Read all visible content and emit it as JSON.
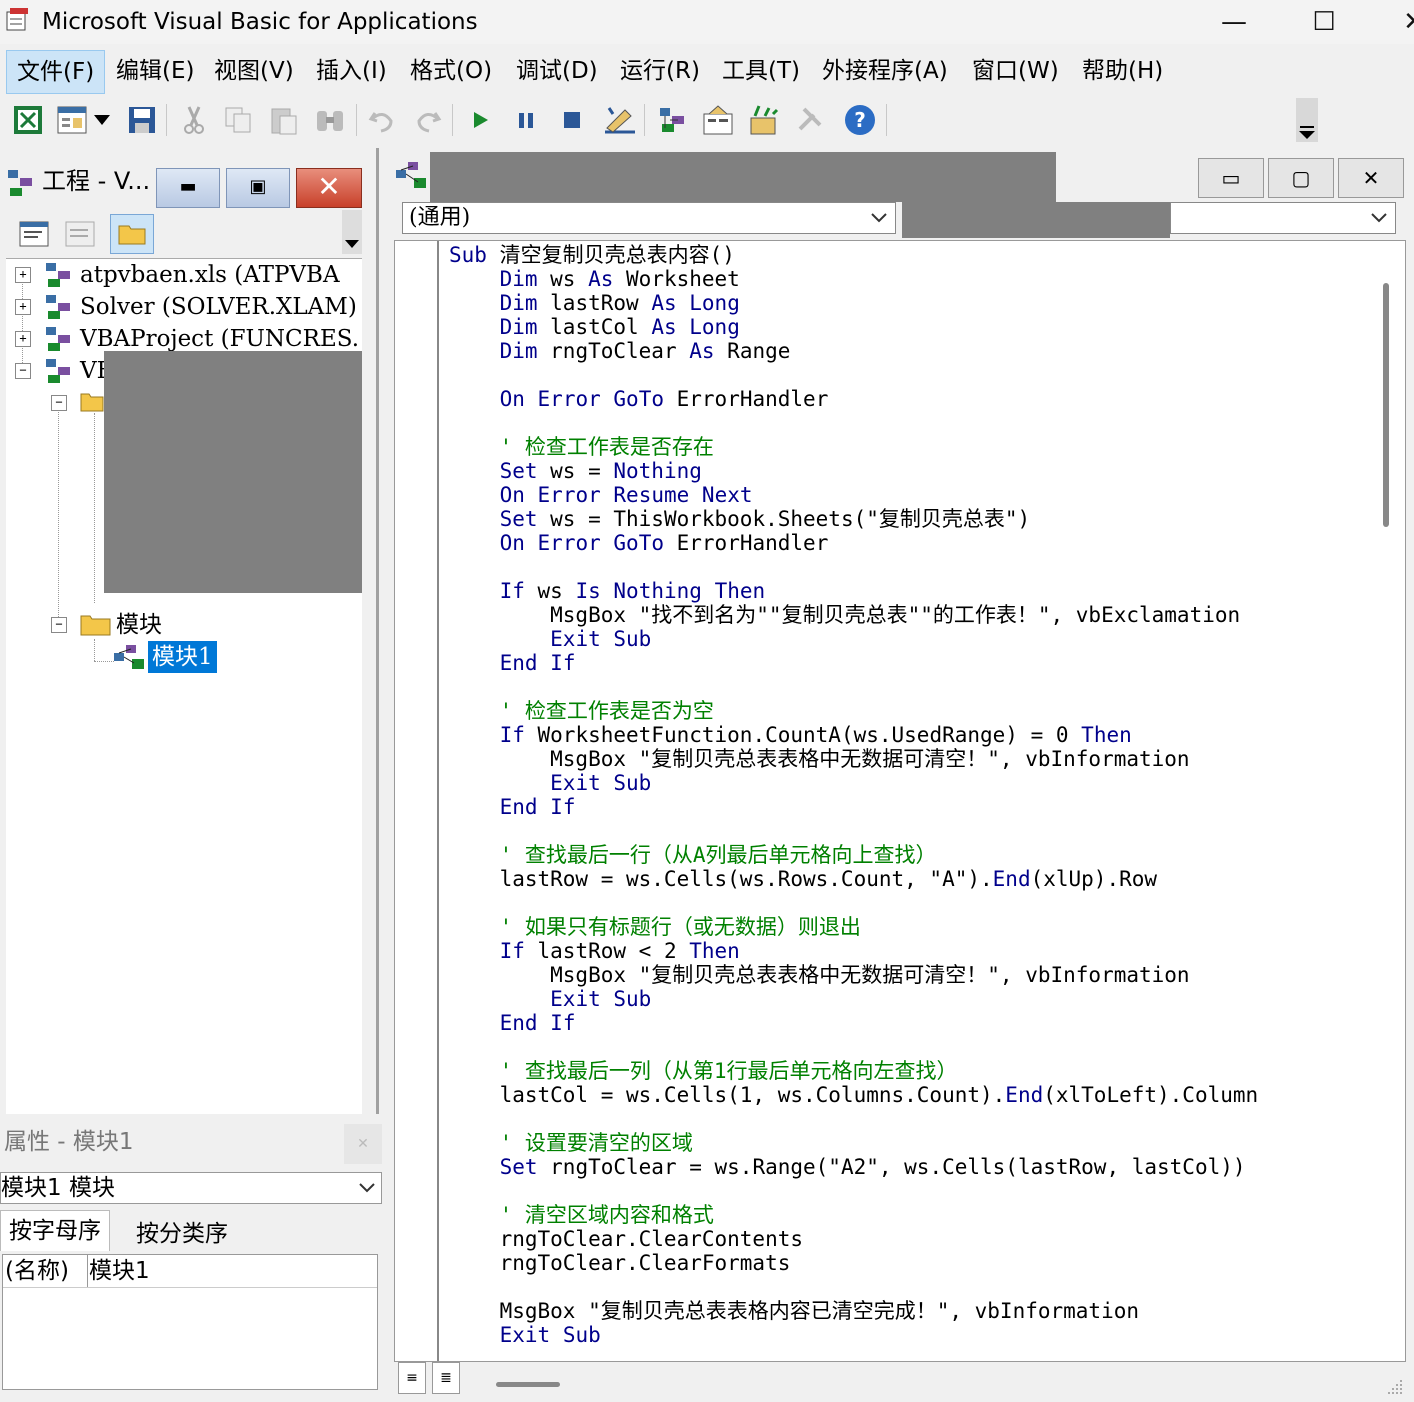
{
  "window": {
    "title": "Microsoft Visual Basic for Applications"
  },
  "menu": [
    "文件(F)",
    "编辑(E)",
    "视图(V)",
    "插入(I)",
    "格式(O)",
    "调试(D)",
    "运行(R)",
    "工具(T)",
    "外接程序(A)",
    "窗口(W)",
    "帮助(H)"
  ],
  "project": {
    "title": "工程 - V...",
    "tree": [
      {
        "label": "atpvbaen.xls (ATPVBA"
      },
      {
        "label": "Solver (SOLVER.XLAM)"
      },
      {
        "label": "VBAProject (FUNCRES."
      },
      {
        "label": "VE"
      },
      {
        "label": "模块"
      },
      {
        "label": "模块1"
      }
    ]
  },
  "properties": {
    "title": "属性 - 模块1",
    "object": "模块1 模块",
    "tabs": [
      "按字母序",
      "按分类序"
    ],
    "row_name": "(名称)",
    "row_value": "模块1"
  },
  "code": {
    "object_combo": "(通用)",
    "lines": [
      {
        "t": "Sub 清空复制贝壳总表内容()",
        "c": "code"
      },
      {
        "t": "    Dim ws As Worksheet",
        "c": "code"
      },
      {
        "t": "    Dim lastRow As Long",
        "c": "code"
      },
      {
        "t": "    Dim lastCol As Long",
        "c": "code"
      },
      {
        "t": "    Dim rngToClear As Range",
        "c": "code"
      },
      {
        "t": "",
        "c": "code"
      },
      {
        "t": "    On Error GoTo ErrorHandler",
        "c": "code"
      },
      {
        "t": "",
        "c": "code"
      },
      {
        "t": "    ' 检查工作表是否存在",
        "c": "comment"
      },
      {
        "t": "    Set ws = Nothing",
        "c": "code"
      },
      {
        "t": "    On Error Resume Next",
        "c": "code"
      },
      {
        "t": "    Set ws = ThisWorkbook.Sheets(\"复制贝壳总表\")",
        "c": "code"
      },
      {
        "t": "    On Error GoTo ErrorHandler",
        "c": "code"
      },
      {
        "t": "",
        "c": "code"
      },
      {
        "t": "    If ws Is Nothing Then",
        "c": "code"
      },
      {
        "t": "        MsgBox \"找不到名为\"\"复制贝壳总表\"\"的工作表！\", vbExclamation",
        "c": "code"
      },
      {
        "t": "        Exit Sub",
        "c": "code"
      },
      {
        "t": "    End If",
        "c": "code"
      },
      {
        "t": "",
        "c": "code"
      },
      {
        "t": "    ' 检查工作表是否为空",
        "c": "comment"
      },
      {
        "t": "    If WorksheetFunction.CountA(ws.UsedRange) = 0 Then",
        "c": "code"
      },
      {
        "t": "        MsgBox \"复制贝壳总表表格中无数据可清空！\", vbInformation",
        "c": "code"
      },
      {
        "t": "        Exit Sub",
        "c": "code"
      },
      {
        "t": "    End If",
        "c": "code"
      },
      {
        "t": "",
        "c": "code"
      },
      {
        "t": "    ' 查找最后一行（从A列最后单元格向上查找）",
        "c": "comment"
      },
      {
        "t": "    lastRow = ws.Cells(ws.Rows.Count, \"A\").End(xlUp).Row",
        "c": "code"
      },
      {
        "t": "",
        "c": "code"
      },
      {
        "t": "    ' 如果只有标题行（或无数据）则退出",
        "c": "comment"
      },
      {
        "t": "    If lastRow < 2 Then",
        "c": "code"
      },
      {
        "t": "        MsgBox \"复制贝壳总表表格中无数据可清空！\", vbInformation",
        "c": "code"
      },
      {
        "t": "        Exit Sub",
        "c": "code"
      },
      {
        "t": "    End If",
        "c": "code"
      },
      {
        "t": "",
        "c": "code"
      },
      {
        "t": "    ' 查找最后一列（从第1行最后单元格向左查找）",
        "c": "comment"
      },
      {
        "t": "    lastCol = ws.Cells(1, ws.Columns.Count).End(xlToLeft).Column",
        "c": "code"
      },
      {
        "t": "",
        "c": "code"
      },
      {
        "t": "    ' 设置要清空的区域",
        "c": "comment"
      },
      {
        "t": "    Set rngToClear = ws.Range(\"A2\", ws.Cells(lastRow, lastCol))",
        "c": "code"
      },
      {
        "t": "",
        "c": "code"
      },
      {
        "t": "    ' 清空区域内容和格式",
        "c": "comment"
      },
      {
        "t": "    rngToClear.ClearContents",
        "c": "code"
      },
      {
        "t": "    rngToClear.ClearFormats",
        "c": "code"
      },
      {
        "t": "",
        "c": "code"
      },
      {
        "t": "    MsgBox \"复制贝壳总表表格内容已清空完成！\", vbInformation",
        "c": "code"
      },
      {
        "t": "    Exit Sub",
        "c": "code"
      }
    ]
  },
  "colors": {
    "keyword": "#00008b",
    "comment": "#008000",
    "selection": "#0078d7"
  }
}
